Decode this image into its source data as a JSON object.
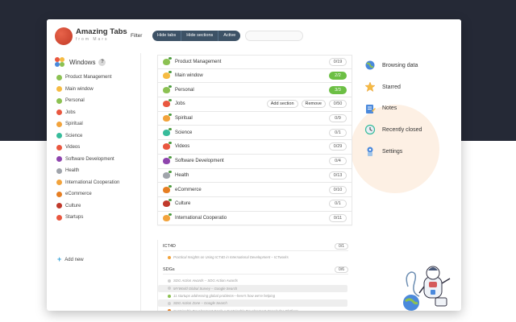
{
  "app": {
    "logo_title": "Amazing Tabs",
    "logo_subtitle": "from Mars"
  },
  "header": {
    "filter_label": "Filter",
    "filter_buttons": [
      "Hide tabs",
      "Hide sections",
      "Active"
    ],
    "search_placeholder": ""
  },
  "sidebar": {
    "title": "Windows",
    "help": "?",
    "items": [
      {
        "label": "Product Management",
        "color": "#8cc152"
      },
      {
        "label": "Main window",
        "color": "#f6bb42"
      },
      {
        "label": "Personal",
        "color": "#8cc152"
      },
      {
        "label": "Jobs",
        "color": "#e9573f"
      },
      {
        "label": "Spiritual",
        "color": "#f2a33c"
      },
      {
        "label": "Science",
        "color": "#37bc9b"
      },
      {
        "label": "Videos",
        "color": "#e9573f"
      },
      {
        "label": "Software Development",
        "color": "#8e44ad"
      },
      {
        "label": "Health",
        "color": "#a0a4ab"
      },
      {
        "label": "International Cooperation",
        "color": "#f2a33c"
      },
      {
        "label": "eCommerce",
        "color": "#e67e22"
      },
      {
        "label": "Culture",
        "color": "#c0392b"
      },
      {
        "label": "Startups",
        "color": "#e9573f"
      }
    ],
    "add_new": "Add new"
  },
  "windows": [
    {
      "label": "Product Management",
      "count": "0/19",
      "color": "#8cc152",
      "active": false
    },
    {
      "label": "Main window",
      "count": "2/2",
      "color": "#f6bb42",
      "active": true
    },
    {
      "label": "Personal",
      "count": "3/3",
      "color": "#8cc152",
      "active": true
    },
    {
      "label": "Jobs",
      "count": "0/50",
      "color": "#e9573f",
      "active": false,
      "buttons": [
        "Add section",
        "Remove"
      ]
    },
    {
      "label": "Spiritual",
      "count": "0/9",
      "color": "#f2a33c",
      "active": false
    },
    {
      "label": "Science",
      "count": "0/1",
      "color": "#37bc9b",
      "active": false
    },
    {
      "label": "Videos",
      "count": "0/29",
      "color": "#e9573f",
      "active": false
    },
    {
      "label": "Software Development",
      "count": "0/4",
      "color": "#8e44ad",
      "active": false
    },
    {
      "label": "Health",
      "count": "0/13",
      "color": "#a0a4ab",
      "active": false
    },
    {
      "label": "eCommerce",
      "count": "0/10",
      "color": "#e67e22",
      "active": false
    },
    {
      "label": "Culture",
      "count": "0/1",
      "color": "#c0392b",
      "active": false
    },
    {
      "label": "International Cooperatio",
      "count": "0/11",
      "color": "#f2a33c",
      "active": false
    }
  ],
  "sections": [
    {
      "label": "ICT4D",
      "count": "0/1",
      "tabs": [
        {
          "text": "Practical Insights on Using ICT4D in International Development – ICTworks",
          "icon_color": "#f2a33c",
          "shaded": false
        }
      ]
    },
    {
      "label": "SDGs",
      "count": "0/6",
      "tabs": [
        {
          "text": "SDG Action Awards – SDG Action Awards",
          "icon_color": "#d0d0d0",
          "shaded": false
        },
        {
          "text": "MYWorld Global Survey – Google Search",
          "icon_color": "#d0d0d0",
          "shaded": true
        },
        {
          "text": "11 startups addressing global problems—here's how we're helping",
          "icon_color": "#8cc152",
          "shaded": false
        },
        {
          "text": "SDG Action Zone – Google Search",
          "icon_color": "#d0d0d0",
          "shaded": true
        },
        {
          "text": "Sustainable Development Goals :: Sustainable Development Knowledge Platform",
          "icon_color": "#e67e22",
          "shaded": false
        }
      ]
    }
  ],
  "right_menu": [
    {
      "label": "Browsing data",
      "icon": "globe-icon"
    },
    {
      "label": "Starred",
      "icon": "star-icon"
    },
    {
      "label": "Notes",
      "icon": "notes-icon"
    },
    {
      "label": "Recently closed",
      "icon": "clock-icon"
    },
    {
      "label": "Settings",
      "icon": "settings-icon"
    }
  ]
}
